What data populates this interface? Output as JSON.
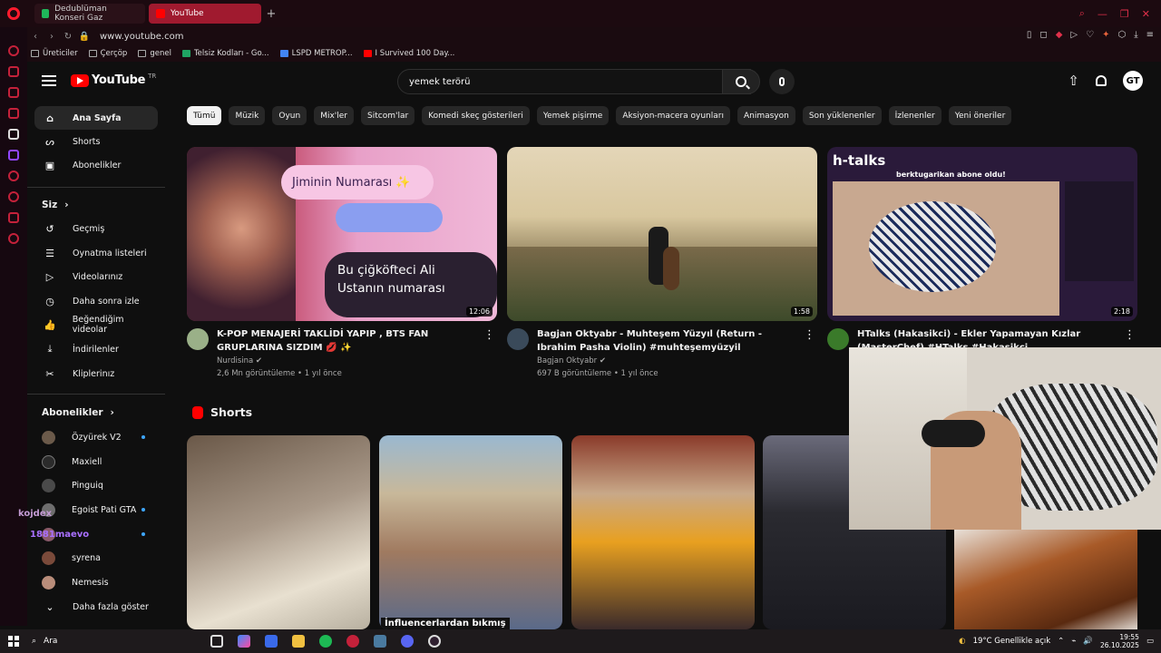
{
  "browser": {
    "tabs": [
      {
        "label": "Dedublüman Konseri Gaz",
        "active": false
      },
      {
        "label": "YouTube",
        "active": true
      }
    ],
    "url": "www.youtube.com",
    "bookmarks": [
      "Üreticiler",
      "Çerçöp",
      "genel",
      "Telsiz Kodları - Go...",
      "LSPD METROP...",
      "I Survived 100 Day..."
    ]
  },
  "header": {
    "logo_text": "YouTube",
    "region": "TR",
    "search_value": "yemek terörü",
    "avatar_text": "GT"
  },
  "sidebar": {
    "main": [
      "Ana Sayfa",
      "Shorts",
      "Abonelikler"
    ],
    "you_title": "Siz",
    "you_items": [
      "Geçmiş",
      "Oynatma listeleri",
      "Videolarınız",
      "Daha sonra izle",
      "Beğendiğim videolar",
      "İndirilenler",
      "Kliplerinız"
    ],
    "subs_title": "Abonelikler",
    "subs": [
      "Özyürek V2",
      "Maxiell",
      "Pinguiq",
      "Egoist Pati GTA",
      "",
      "syrena",
      "Nemesis"
    ],
    "show_more": "Daha fazla göster"
  },
  "chips": [
    "Tümü",
    "Müzik",
    "Oyun",
    "Mix'ler",
    "Sitcom'lar",
    "Komedi skeç gösterileri",
    "Yemek pişirme",
    "Aksiyon-macera oyunları",
    "Animasyon",
    "Son yüklenenler",
    "İzlenenler",
    "Yeni öneriler"
  ],
  "videos": [
    {
      "title": "K-POP MENAJERİ TAKLİDİ YAPIP , BTS FAN GRUPLARINA SIZDIM 💋 ✨",
      "channel": "Nurdisina ✔",
      "stats": "2,6 Mn görüntüleme • 1 yıl önce",
      "duration": "12:06",
      "thumb_text_1": "Jiminin Numarası ✨",
      "thumb_text_2": "Bu çiğköfteci Ali Ustanın numarası"
    },
    {
      "title": "Bagjan Oktyabr - Muhteşem Yüzyıl (Return - Ibrahim Pasha Violin) #muhteşemyüzyil",
      "channel": "Bagjan Oktyabr ✔",
      "stats": "697 B görüntüleme • 1 yıl önce",
      "duration": "1:58"
    },
    {
      "title": "HTalks (Hakasikci) - Ekler Yapamayan Kızlar (MasterChef) #HTalks #Hakasikci",
      "channel": "",
      "stats": "",
      "duration": "2:18",
      "thumb_text_1": "h-talks",
      "thumb_text_2": "berktugarikan abone oldu!"
    }
  ],
  "shorts_title": "Shorts",
  "shorts_caption": "İnfluencerlardan bıkmış",
  "overlay": {
    "chat_user_1": "kojdex",
    "chat_user_2": "1881maevo"
  },
  "taskbar": {
    "search": "Ara",
    "weather": "19°C  Genellikle açık",
    "time": "19:55",
    "date": "26.10.2025"
  },
  "colors": {
    "accent": "#ff0000",
    "browser": "#1c0a10",
    "bg": "#0f0f0f"
  }
}
